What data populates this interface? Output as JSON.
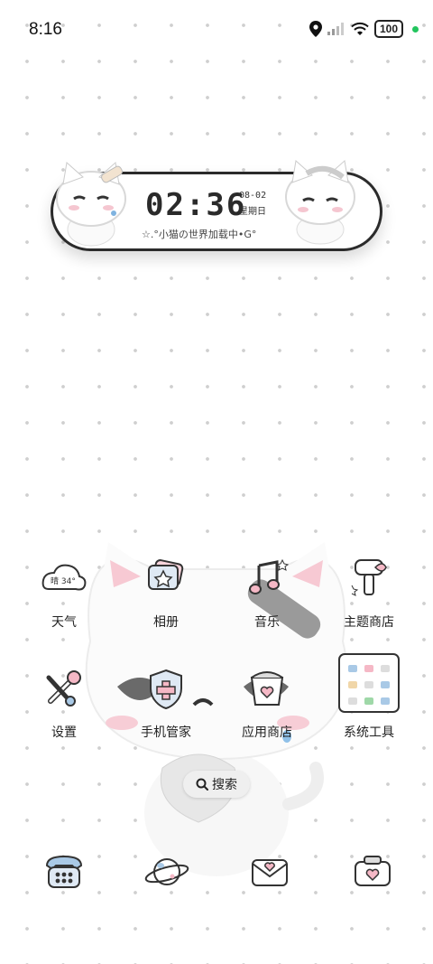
{
  "status_bar": {
    "time": "8:16",
    "battery": "100"
  },
  "clock_widget": {
    "time": "02:36",
    "date": "08-02",
    "weekday": "星期日",
    "slogan": "☆.°小猫の世界加载中•G°"
  },
  "apps": [
    {
      "label": "天气",
      "icon": "weather-cloud-icon",
      "icon_text": "晴 34°"
    },
    {
      "label": "相册",
      "icon": "photo-album-icon"
    },
    {
      "label": "音乐",
      "icon": "music-note-icon"
    },
    {
      "label": "主题商店",
      "icon": "paint-brush-icon"
    },
    {
      "label": "设置",
      "icon": "wrench-icon"
    },
    {
      "label": "手机管家",
      "icon": "shield-icon"
    },
    {
      "label": "应用商店",
      "icon": "app-store-cup-icon"
    },
    {
      "label": "系统工具",
      "icon": "folder-icon"
    }
  ],
  "search": {
    "label": "搜索",
    "icon": "search-icon"
  },
  "dock": [
    {
      "icon": "telephone-icon"
    },
    {
      "icon": "planet-chat-icon"
    },
    {
      "icon": "envelope-icon"
    },
    {
      "icon": "camera-icon"
    }
  ],
  "colors": {
    "accent_pink": "#f5b8c6",
    "outline": "#2b2b2b",
    "light_blue": "#a9c9e6",
    "status_green": "#22c55e"
  }
}
